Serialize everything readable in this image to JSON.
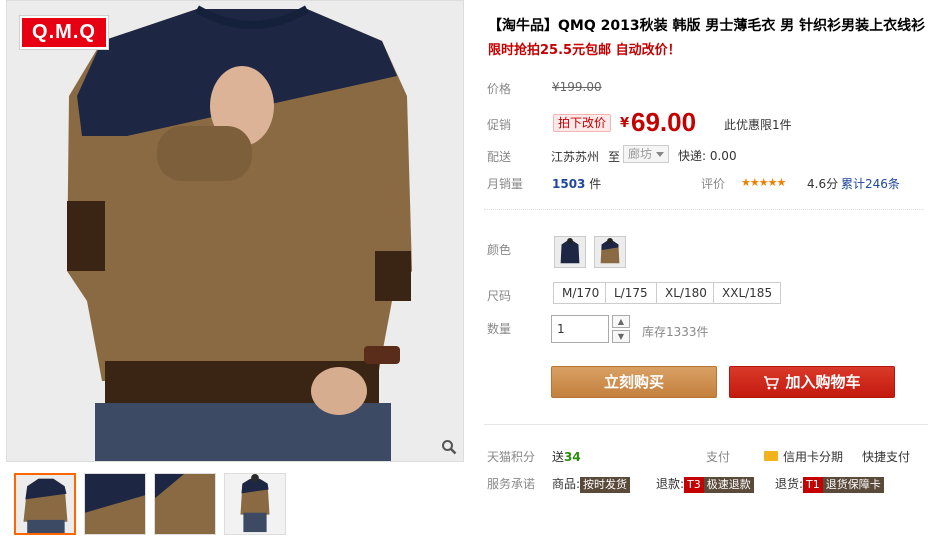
{
  "gallery": {
    "brand_logo": "Q.M.Q",
    "zoom_icon": "zoom-icon",
    "thumbnails": [
      "thumb-1",
      "thumb-2",
      "thumb-3",
      "thumb-4"
    ]
  },
  "product": {
    "title": "【淘牛品】QMQ 2013秋装 韩版 男士薄毛衣 男 针织衫男装上衣线衫",
    "subtitle": "限时抢拍25.5元包邮 自动改价！",
    "price_label": "价格",
    "original_price": "¥199.00",
    "promo_label": "促销",
    "promo_tag": "拍下改价",
    "currency": "¥",
    "promo_price": "69.00",
    "promo_note": "此优惠限1件",
    "shipping_label": "配送",
    "ship_from": "江苏苏州",
    "ship_to_word": "至",
    "ship_dest": "廊坊",
    "ship_fee": "快递: 0.00",
    "sales_label": "月销量",
    "sales_count": "1503",
    "sales_unit": "件",
    "review_label": "评价",
    "stars": "★★★★★",
    "rating": "4.6分",
    "review_count": "累计246条"
  },
  "sku": {
    "color_label": "颜色",
    "size_label": "尺码",
    "sizes": [
      "M/170",
      "L/175",
      "XL/180",
      "XXL/185"
    ],
    "quantity_label": "数量",
    "quantity_value": "1",
    "stock": "库存1333件"
  },
  "actions": {
    "buy_now": "立刻购买",
    "add_to_cart": "加入购物车"
  },
  "service": {
    "points_label": "天猫积分",
    "points_prefix": "送",
    "points_value": "34",
    "pay_label": "支付",
    "installment": "信用卡分期",
    "quick_pay": "快捷支付",
    "promise_label": "服务承诺",
    "goods_prefix": "商品:",
    "goods_badge": "按时发货",
    "refund_prefix": "退款:",
    "refund_code": "T3",
    "refund_badge": "极速退款",
    "return_prefix": "退货:",
    "return_code": "T1",
    "return_badge": "退货保障卡"
  },
  "colors": {
    "price_red": "#c40000",
    "buy_orange": "#c4803d",
    "cart_red": "#c4190e",
    "link_blue": "#21489c"
  }
}
